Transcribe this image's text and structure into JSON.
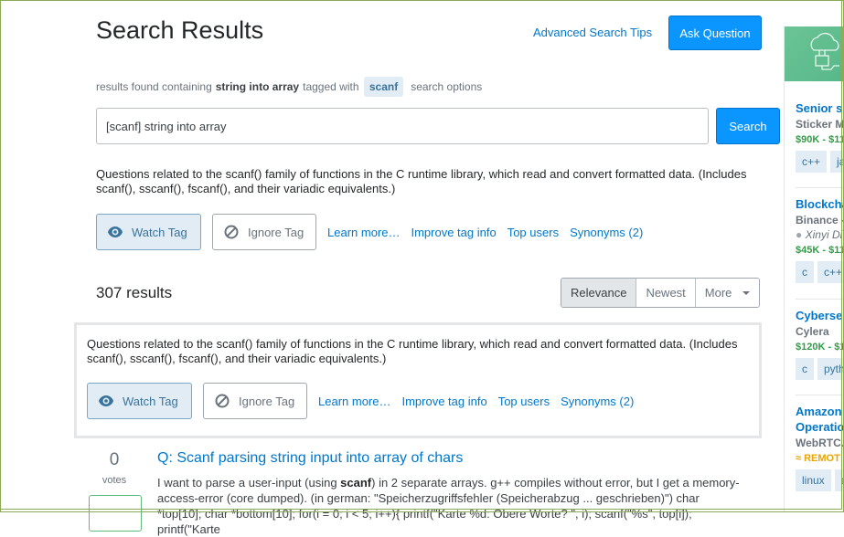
{
  "header": {
    "title": "Search Results",
    "advanced_tips_link": "Advanced Search Tips",
    "ask_question_button": "Ask Question"
  },
  "summary": {
    "prefix": "results found containing",
    "query_terms": "string into array",
    "tagged_with": "tagged with",
    "tag": "scanf",
    "search_options_link": "search options"
  },
  "search": {
    "value": "[scanf] string into array",
    "button": "Search"
  },
  "tag_info": {
    "description": "Questions related to the scanf() family of functions in the C runtime library, which read and convert formatted data. (Includes scanf(), sscanf(), fscanf(), and their variadic equivalents.)",
    "watch_button": "Watch Tag",
    "ignore_button": "Ignore Tag",
    "links": {
      "learn_more": "Learn more…",
      "improve": "Improve tag info",
      "top_users": "Top users",
      "synonyms": "Synonyms (2)"
    }
  },
  "results": {
    "count_label": "307 results",
    "sort_options": [
      "Relevance",
      "Newest",
      "More"
    ],
    "active_sort": "Relevance"
  },
  "questions": [
    {
      "votes": "0",
      "votes_label": "votes",
      "title": "Q: Scanf parsing string input into array of chars",
      "excerpt_before": "I want to parse a user-input (using ",
      "excerpt_bold": "scanf",
      "excerpt_after": ") in 2 separate arrays. g++ compiles without error, but I get a memory-access-error (core dumped). (in german: \"Speicherzugriffsfehler (Speicherabzug ... geschrieben)\") char *top[10]; char *bottom[10]; for(i = 0; i < 5; i++){ printf(\"Karte %d: Obere Worte? \", i); scanf(\"%s\", top[i]); printf(\"Karte"
    }
  ],
  "sidebar": {
    "jobs": [
      {
        "title": "Senior s",
        "company": "Sticker M",
        "salary": "$90K - $11",
        "tags": [
          "c++",
          "ja"
        ]
      },
      {
        "title": "Blockcha",
        "company": "Binance -",
        "location": "Xinyi Di",
        "salary": "$45K - $11",
        "tags": [
          "c",
          "c++"
        ]
      },
      {
        "title": "Cybersec",
        "company": "Cylera",
        "salary": "$120K - $1",
        "tags": [
          "c",
          "pyth"
        ]
      },
      {
        "title": "Amazon Operatio",
        "company": "WebRTC.",
        "remote": "REMOT",
        "tags": [
          "linux",
          "a"
        ]
      }
    ]
  }
}
